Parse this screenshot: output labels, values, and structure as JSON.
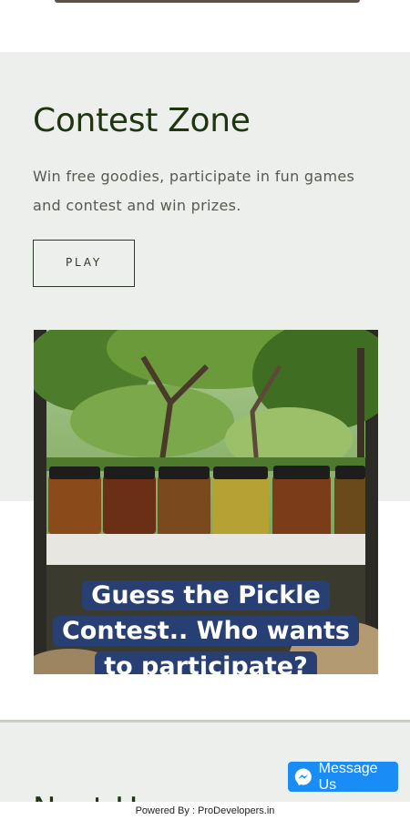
{
  "contest": {
    "title": "Contest Zone",
    "description": "Win free goodies, participate in fun games and contest and win prizes.",
    "play_label": "PLAY"
  },
  "media": {
    "caption_lines": [
      "Guess the Pickle",
      "Contest.. Who wants",
      "to participate?"
    ],
    "caption_bg": "#283f73"
  },
  "next_section": {
    "heading_peek": "Next Hun"
  },
  "messenger": {
    "label": "Message Us",
    "color": "#1a8cf5",
    "icon": "messenger-icon"
  },
  "footer": {
    "powered_by": "Powered By : ProDevelopers.in"
  },
  "colors": {
    "section_bg": "#ecefec",
    "heading": "#1e3510"
  }
}
